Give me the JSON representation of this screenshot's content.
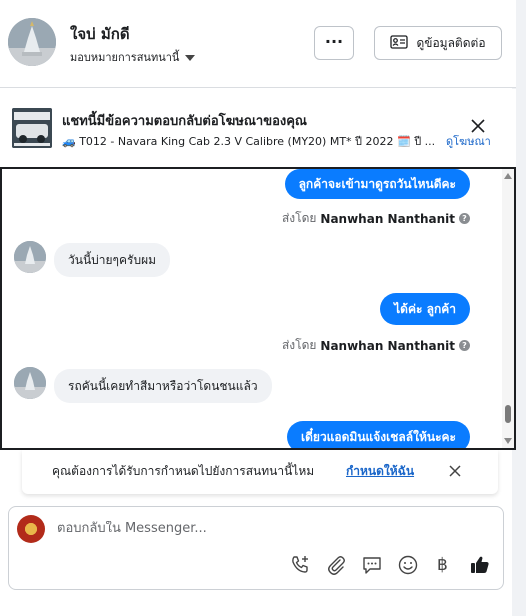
{
  "header": {
    "contact_name": "ใจบ่ มักดี",
    "assign_label": "มอบหมายการสนทนานี้",
    "more_label": "···",
    "view_contact_label": "ดูข้อมูลติดต่อ"
  },
  "ad_banner": {
    "title": "แชทนี้มีข้อความตอบกลับต่อโฆษณาของคุณ",
    "detail": "🚙 T012 - Navara King Cab 2.3 V Calibre (MY20) MT* ปี 2022 🗓️ ปี ...",
    "view_ad_label": "ดูโฆษณา"
  },
  "messages": [
    {
      "text": "ลูกค้าจะเข้ามาดูรถวันไหนดีคะ"
    },
    {
      "sent_by_prefix": "ส่งโดย",
      "sent_by_name": "Nanwhan Nanthanit"
    },
    {
      "text": "วันนี้บ่ายๆครับผม"
    },
    {
      "text": "ได้ค่ะ  ลูกค้า"
    },
    {
      "sent_by_prefix": "ส่งโดย",
      "sent_by_name": "Nanwhan Nanthanit"
    },
    {
      "text": "รถคันนี้เคยทำสีมาหรือว่าโดนชนแล้ว"
    },
    {
      "text": "เดี๋ยวแอดมินแจ้งเชลล์ให้นะคะ"
    }
  ],
  "assign_prompt": {
    "text": "คุณต้องการได้รับการกำหนดไปยังการสนทนานี้ไหม",
    "action_label": "กำหนดให้ฉัน"
  },
  "composer": {
    "placeholder": "ตอบกลับใน Messenger...",
    "currency_symbol": "฿"
  },
  "colors": {
    "outgoing_bubble": "#0a7cff",
    "incoming_bubble": "#f0f2f5",
    "link": "#1a66c9"
  }
}
